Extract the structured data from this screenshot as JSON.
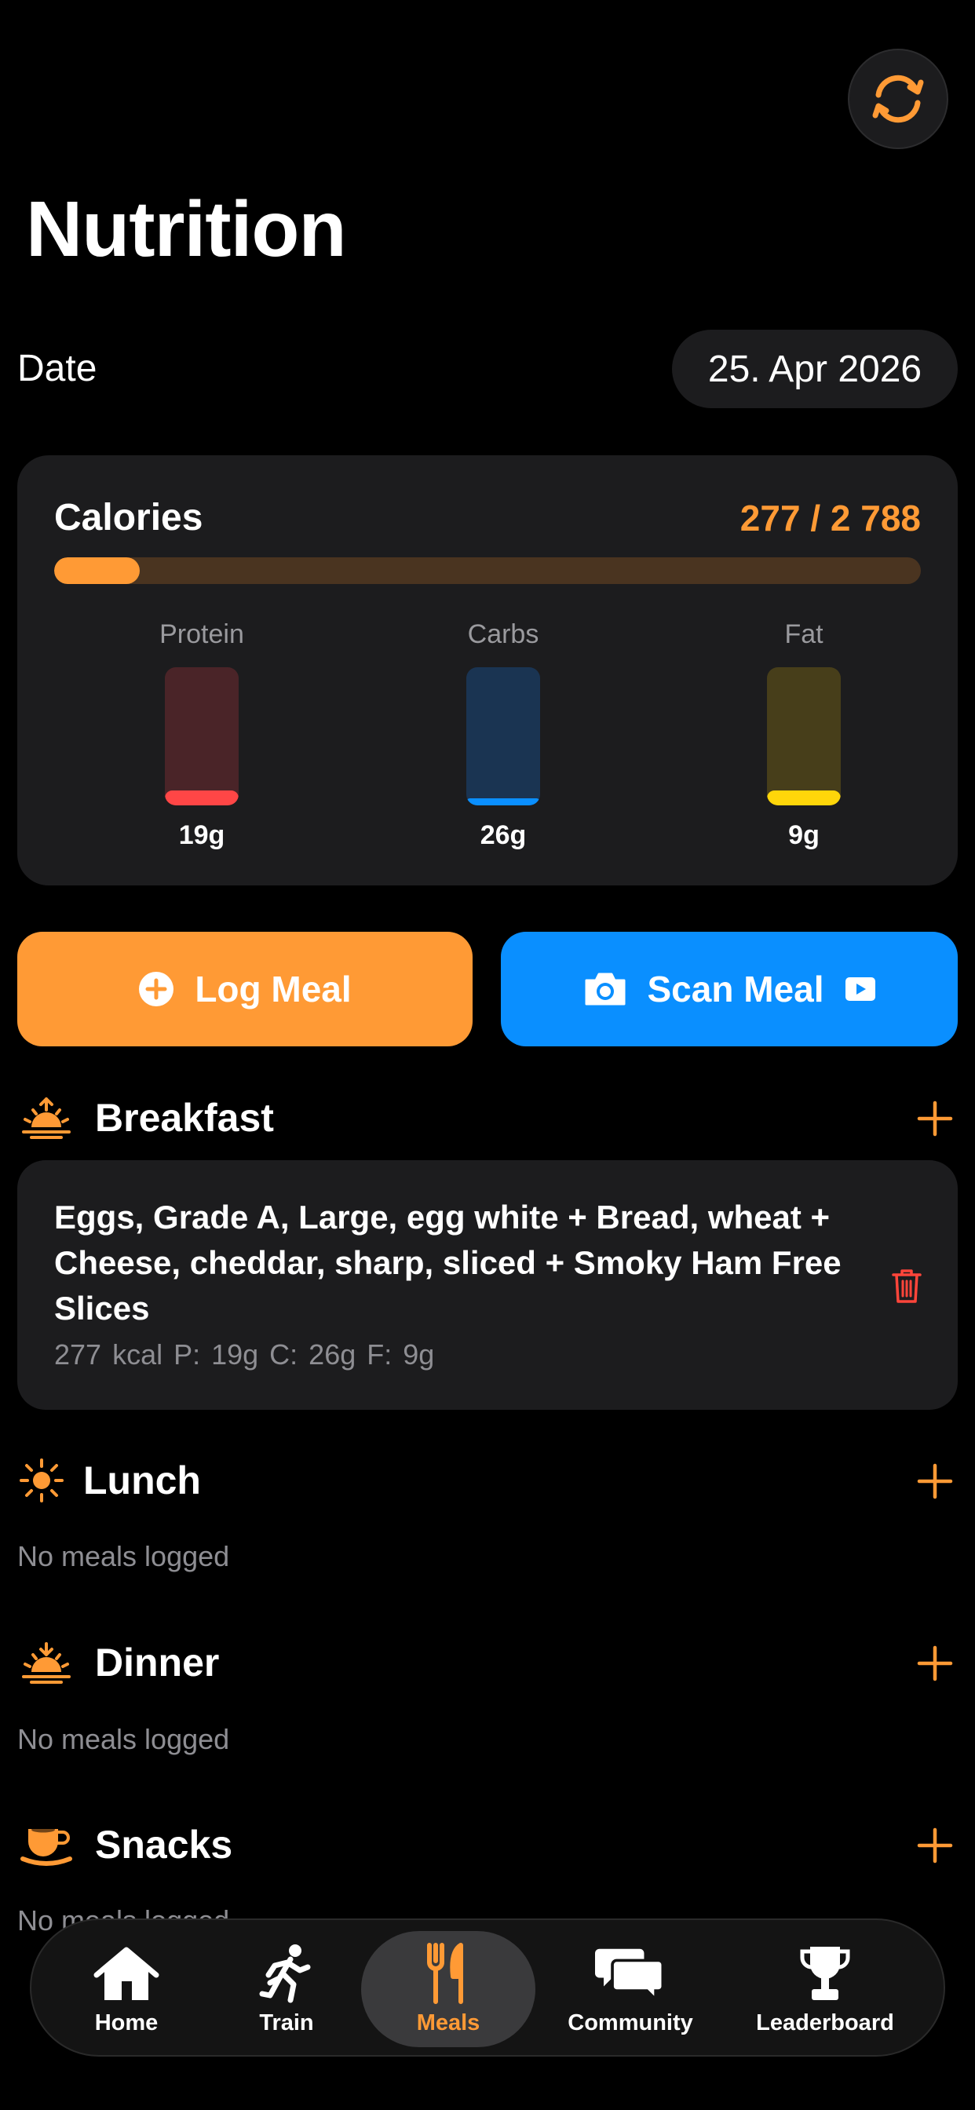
{
  "header": {
    "title": "Nutrition",
    "sync_icon": "sync-icon"
  },
  "date": {
    "label": "Date",
    "value": "25. Apr 2026"
  },
  "calories": {
    "label": "Calories",
    "value_text": "277 / 2 788",
    "consumed": 277,
    "goal": 2788,
    "progress": 0.099
  },
  "macros": [
    {
      "name": "Protein",
      "amount": "19g",
      "fill": 0.11,
      "color": "#ff4646",
      "track": "#4a2428"
    },
    {
      "name": "Carbs",
      "amount": "26g",
      "fill": 0.05,
      "color": "#0a8fff",
      "track": "#1a3452"
    },
    {
      "name": "Fat",
      "amount": "9g",
      "fill": 0.11,
      "color": "#ffd60a",
      "track": "#473e1a"
    }
  ],
  "actions": {
    "log_label": "Log Meal",
    "scan_label": "Scan Meal"
  },
  "sections": {
    "breakfast": {
      "title": "Breakfast",
      "meal": {
        "name": "Eggs, Grade A, Large, egg white + Bread, wheat + Cheese, cheddar, sharp, sliced + Smoky Ham Free Slices",
        "stats": "277 kcal   P: 19g   C: 26g   F: 9g"
      }
    },
    "lunch": {
      "title": "Lunch",
      "empty": "No meals logged"
    },
    "dinner": {
      "title": "Dinner",
      "empty": "No meals logged"
    },
    "snacks": {
      "title": "Snacks",
      "empty": "No meals logged"
    }
  },
  "tabs": [
    {
      "label": "Home",
      "icon": "home-icon"
    },
    {
      "label": "Train",
      "icon": "runner-icon"
    },
    {
      "label": "Meals",
      "icon": "fork-knife-icon",
      "active": true
    },
    {
      "label": "Community",
      "icon": "chat-bubbles-icon"
    },
    {
      "label": "Leaderboard",
      "icon": "trophy-icon"
    }
  ],
  "colors": {
    "accent": "#ff9a35",
    "blue": "#0a8fff",
    "danger": "#ff453a",
    "card": "#1c1c1e"
  }
}
